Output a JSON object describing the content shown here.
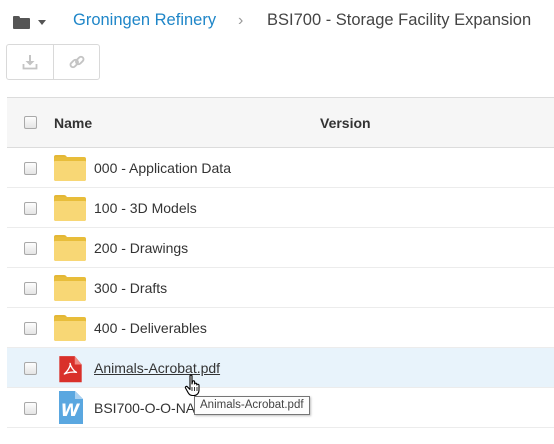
{
  "breadcrumb": {
    "folder_menu_icon": "folder-icon",
    "parent": "Groningen Refinery",
    "separator": "›",
    "current": "BSI700 - Storage Facility Expansion"
  },
  "toolbar": {
    "buttons": [
      {
        "icon": "download-icon",
        "enabled": false
      },
      {
        "icon": "link-icon",
        "enabled": false
      }
    ]
  },
  "table": {
    "columns": {
      "name": "Name",
      "version": "Version"
    },
    "rows": [
      {
        "type": "folder",
        "name": "000 - Application Data"
      },
      {
        "type": "folder",
        "name": "100 - 3D Models"
      },
      {
        "type": "folder",
        "name": "200 - Drawings"
      },
      {
        "type": "folder",
        "name": "300 - Drafts"
      },
      {
        "type": "folder",
        "name": "400 - Deliverables"
      },
      {
        "type": "pdf",
        "name": "Animals-Acrobat.pdf",
        "hovered": true
      },
      {
        "type": "word",
        "name": "BSI700-O-O-NA"
      }
    ]
  },
  "tooltip": "Animals-Acrobat.pdf",
  "colors": {
    "link": "#1f86c8",
    "folder": "#f8d775",
    "pdf_red": "#d9302a",
    "word_blue": "#5aa7e0",
    "hover_row": "#e8f3fb"
  }
}
